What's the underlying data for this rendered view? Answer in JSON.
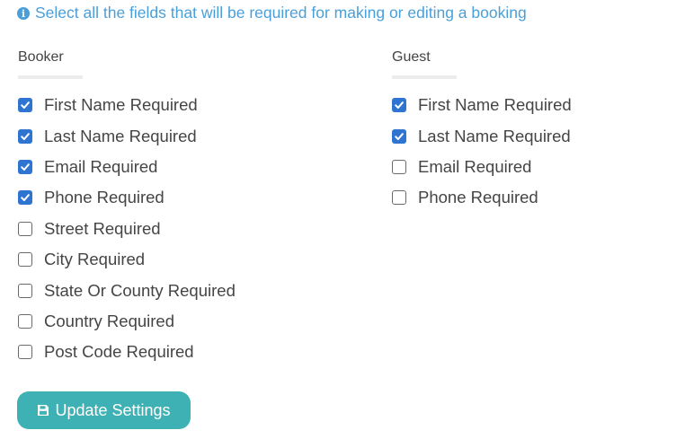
{
  "info_message": "Select all the fields that will be required for making or editing a booking",
  "booker": {
    "title": "Booker",
    "fields": [
      {
        "label": "First Name Required",
        "checked": true
      },
      {
        "label": "Last Name Required",
        "checked": true
      },
      {
        "label": "Email Required",
        "checked": true
      },
      {
        "label": "Phone Required",
        "checked": true
      },
      {
        "label": "Street Required",
        "checked": false
      },
      {
        "label": "City Required",
        "checked": false
      },
      {
        "label": "State Or County Required",
        "checked": false
      },
      {
        "label": "Country Required",
        "checked": false
      },
      {
        "label": "Post Code Required",
        "checked": false
      }
    ]
  },
  "guest": {
    "title": "Guest",
    "fields": [
      {
        "label": "First Name Required",
        "checked": true
      },
      {
        "label": "Last Name Required",
        "checked": true
      },
      {
        "label": "Email Required",
        "checked": false
      },
      {
        "label": "Phone Required",
        "checked": false
      }
    ]
  },
  "update_button": {
    "label": "Update Settings",
    "icon": "save-icon"
  },
  "colors": {
    "accent": "#4a9fd8",
    "checkbox_checked": "#2f74d0",
    "button": "#3db1b4"
  }
}
